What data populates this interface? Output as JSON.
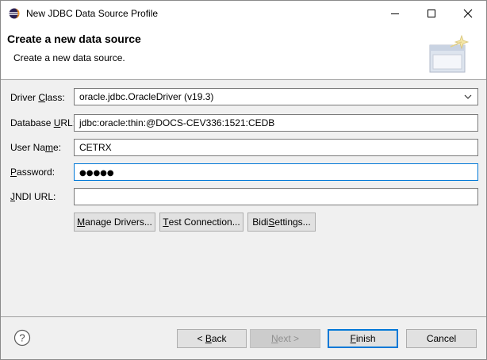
{
  "window": {
    "title": "New JDBC Data Source Profile"
  },
  "banner": {
    "title": "Create a new data source",
    "subtitle": "Create a new data source."
  },
  "form": {
    "driver_class": {
      "label_pre": "Driver ",
      "label_mnemonic": "C",
      "label_post": "lass:",
      "value": "oracle.jdbc.OracleDriver (v19.3)"
    },
    "database_url": {
      "label_pre": "Database ",
      "label_mnemonic": "U",
      "label_post": "RL:",
      "value": "jdbc:oracle:thin:@DOCS-CEV336:1521:CEDB"
    },
    "user_name": {
      "label_pre": "User Na",
      "label_mnemonic": "m",
      "label_post": "e:",
      "value": "CETRX"
    },
    "password": {
      "label_pre": "",
      "label_mnemonic": "P",
      "label_post": "assword:",
      "value": "●●●●●"
    },
    "jndi_url": {
      "label_pre": "",
      "label_mnemonic": "J",
      "label_post": "NDI URL:",
      "value": ""
    }
  },
  "actions": {
    "manage_drivers": {
      "pre": "",
      "mnemonic": "M",
      "post": "anage Drivers..."
    },
    "test_connection": {
      "pre": "",
      "mnemonic": "T",
      "post": "est Connection..."
    },
    "bidi_settings": {
      "pre": "Bidi ",
      "mnemonic": "S",
      "post": "ettings..."
    }
  },
  "footer": {
    "back": {
      "pre": "< ",
      "mnemonic": "B",
      "post": "ack"
    },
    "next": {
      "pre": "",
      "mnemonic": "N",
      "post": "ext >"
    },
    "finish": {
      "pre": "",
      "mnemonic": "F",
      "post": "inish"
    },
    "cancel": "Cancel"
  },
  "icons": {
    "app": "eclipse-icon",
    "minimize": "minimize-icon",
    "maximize": "maximize-icon",
    "close": "close-icon",
    "banner": "wizard-banner-icon",
    "help": "help-icon",
    "dropdown": "chevron-down-icon"
  },
  "colors": {
    "focus_border": "#0078d7",
    "window_bg": "#f0f0f0",
    "button_bg": "#e1e1e1"
  }
}
